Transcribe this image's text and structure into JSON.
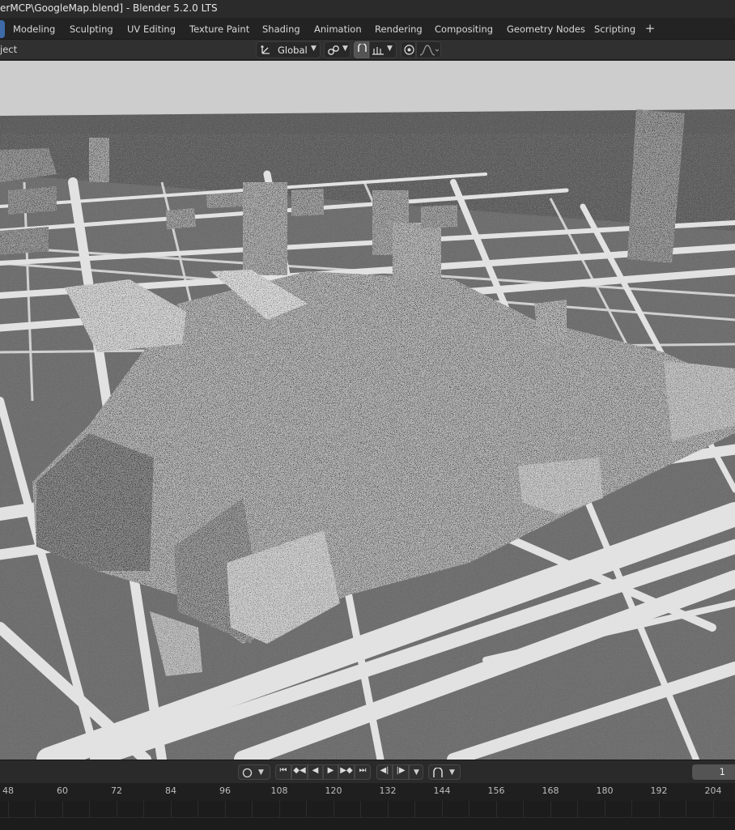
{
  "window": {
    "title": "erMCP\\GoogleMap.blend] - Blender 5.2.0 LTS"
  },
  "workspaces": {
    "tabs": [
      "Modeling",
      "Sculpting",
      "UV Editing",
      "Texture Paint",
      "Shading",
      "Animation",
      "Rendering",
      "Compositing",
      "Geometry Nodes",
      "Scripting"
    ],
    "add_icon": "plus-icon"
  },
  "header": {
    "object_menu_label": "ject",
    "orientation": {
      "value": "Global",
      "icon": "transform-orientation-icon"
    },
    "pivot_icon": "pivot-point-icon",
    "snap_icon": "snap-magnet-icon",
    "snap_target_icon": "snap-increment-icon",
    "proportional_icon": "proportional-editing-icon",
    "falloff_icon": "falloff-curve-icon"
  },
  "viewport": {
    "scene": "3D city map of buildings on a street grid, noisy point rendering",
    "colors": {
      "sky": "#cdcdcd",
      "ground": "#6c6c6c",
      "streets": "#e2e2e2",
      "buildings": "#b8b8b8",
      "shadow": "#2a2a2a"
    }
  },
  "timeline": {
    "playback_icons": [
      "jump-start-icon",
      "prev-keyframe-icon",
      "play-reverse-icon",
      "play-icon",
      "next-keyframe-icon",
      "jump-end-icon"
    ],
    "keyframe_icons": [
      "prev-key-icon",
      "next-key-icon"
    ],
    "auto_key_icon": "record-circle-icon",
    "current_frame": "1",
    "ruler_ticks": [
      "48",
      "60",
      "72",
      "84",
      "96",
      "108",
      "120",
      "132",
      "144",
      "156",
      "168",
      "180",
      "192",
      "204"
    ]
  }
}
